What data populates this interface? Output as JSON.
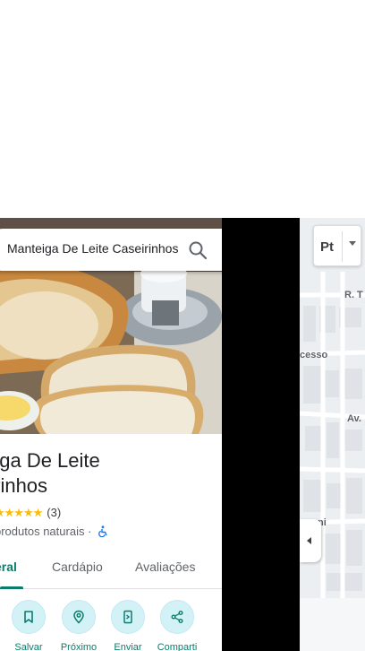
{
  "search": {
    "query": "Manteiga De Leite Caseirinhos"
  },
  "place": {
    "title_line1": "teiga De Leite",
    "title_line2": "eirinhos",
    "stars": "★★★★★",
    "rating_count": "(3)",
    "category": "produtos naturais ·"
  },
  "tabs": [
    {
      "label": "eral",
      "active": true
    },
    {
      "label": "Cardápio",
      "active": false
    },
    {
      "label": "Avaliações",
      "active": false
    }
  ],
  "actions": [
    {
      "label": "Salvar",
      "icon": "bookmark-icon"
    },
    {
      "label": "Próximo",
      "icon": "nearby-icon"
    },
    {
      "label": "Enviar",
      "icon": "send-to-phone-icon"
    },
    {
      "label": "Comparti",
      "icon": "share-icon"
    }
  ],
  "map": {
    "layer_button": "Pt",
    "streets": [
      "R. T",
      "cesso",
      "Av.",
      "ni"
    ]
  },
  "colors": {
    "accent": "#0b7c6b",
    "action_bg": "#d2f2f7",
    "star": "#fbbc04",
    "map_bg": "#ebedf0",
    "accessibility": "#1a73e8"
  }
}
